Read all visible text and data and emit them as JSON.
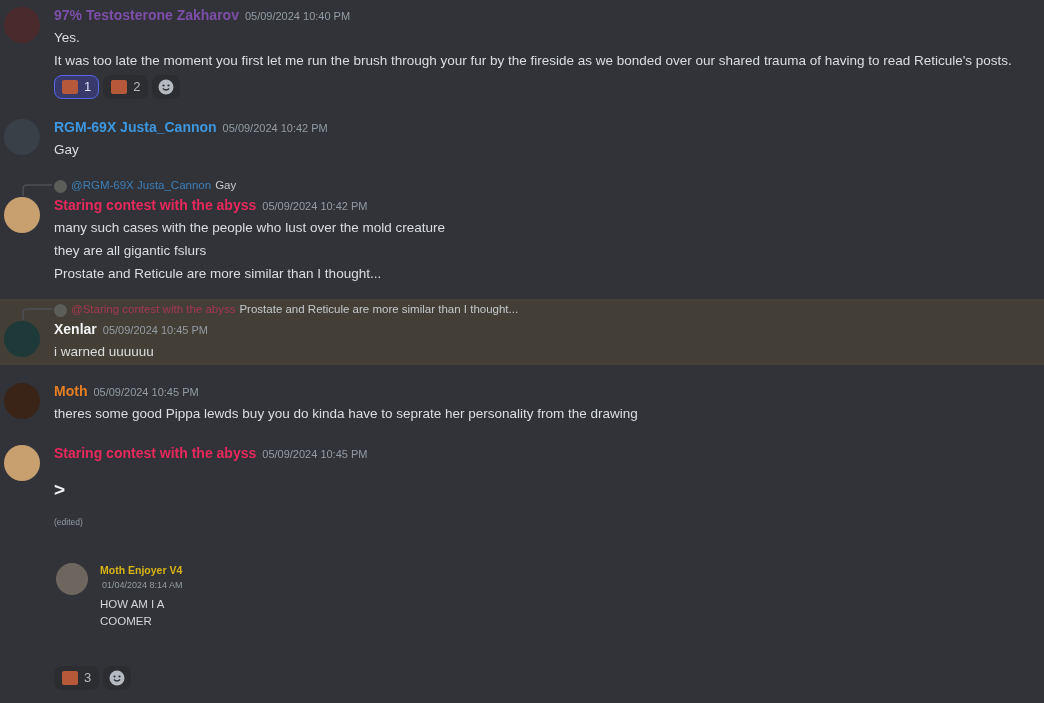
{
  "messages": [
    {
      "author": "97% Testosterone Zakharov",
      "color": "#7d4fab",
      "timestamp": "05/09/2024 10:40 PM",
      "highlighted": false,
      "lines": [
        "Yes.",
        "It was too late the moment you first let me run the brush through your fur by the fireside as we bonded over our shared trauma of having to read Reticule's posts."
      ],
      "reactions": [
        {
          "count": "1",
          "selected": true
        },
        {
          "count": "2",
          "selected": false
        }
      ],
      "add_reaction": true
    },
    {
      "author": "RGM-69X Justa_Cannon",
      "color": "#3d97e0",
      "timestamp": "05/09/2024 10:42 PM",
      "highlighted": false,
      "lines": [
        "Gay"
      ]
    },
    {
      "reply": {
        "author": "@RGM-69X Justa_Cannon",
        "color": "#3d7fb8",
        "text": "Gay"
      },
      "author": "Staring contest with the abyss",
      "color": "#e8285c",
      "timestamp": "05/09/2024 10:42 PM",
      "highlighted": false,
      "lines": [
        "many such cases with the people who lust over the mold creature",
        "they are all gigantic fslurs",
        "Prostate and Reticule are more similar than I thought..."
      ]
    },
    {
      "reply": {
        "author": "@Staring contest with the abyss",
        "color": "#a8364f",
        "text": "Prostate and Reticule are more similar than I thought..."
      },
      "author": "Xenlar",
      "color": "#f2f3f5",
      "timestamp": "05/09/2024 10:45 PM",
      "highlighted": true,
      "lines": [
        "i warned uuuuuu"
      ]
    },
    {
      "author": "Moth",
      "color": "#e67e22",
      "timestamp": "05/09/2024 10:45 PM",
      "highlighted": false,
      "lines": [
        "theres some good Pippa lewds  buy you do kinda have to seprate her personality from the drawing"
      ]
    },
    {
      "author": "Staring contest with the abyss",
      "color": "#e8285c",
      "timestamp": "05/09/2024 10:45 PM",
      "highlighted": false,
      "heading": ">",
      "edited": "(edited)",
      "embed": {
        "author": "Moth Enjoyer V4",
        "color": "#d9b515",
        "timestamp": "01/04/2024 8:14 AM",
        "lines": [
          "HOW AM I A",
          "COOMER"
        ]
      },
      "reactions": [
        {
          "count": "3",
          "selected": false
        }
      ],
      "add_reaction": true
    }
  ]
}
